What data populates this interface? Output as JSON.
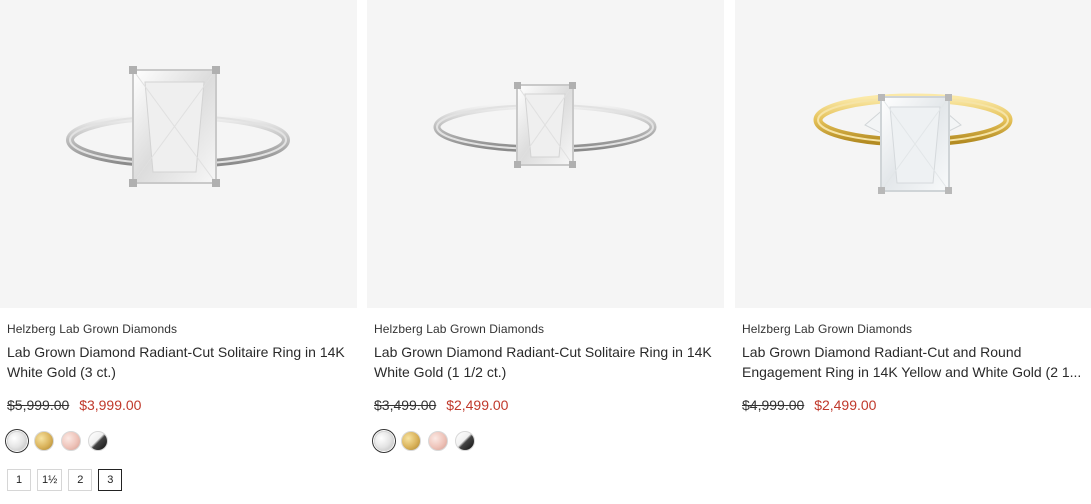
{
  "products": [
    {
      "brand": "Helzberg Lab Grown Diamonds",
      "title": "Lab Grown Diamond Radiant-Cut Solitaire Ring in 14K White Gold (3 ct.)",
      "original_price": "$5,999.00",
      "sale_price": "$3,999.00",
      "metal_swatches": [
        "white-gold",
        "yellow-gold",
        "rose-gold",
        "black-white"
      ],
      "selected_swatch": "white-gold",
      "carat_options": [
        "1",
        "1½",
        "2",
        "3"
      ],
      "selected_carat": "3"
    },
    {
      "brand": "Helzberg Lab Grown Diamonds",
      "title": "Lab Grown Diamond Radiant-Cut Solitaire Ring in 14K White Gold (1 1/2 ct.)",
      "original_price": "$3,499.00",
      "sale_price": "$2,499.00",
      "metal_swatches": [
        "white-gold",
        "yellow-gold",
        "rose-gold",
        "black-white"
      ],
      "selected_swatch": "white-gold"
    },
    {
      "brand": "Helzberg Lab Grown Diamonds",
      "title": "Lab Grown Diamond Radiant-Cut and Round Engagement Ring in 14K Yellow and White Gold (2 1...",
      "original_price": "$4,999.00",
      "sale_price": "$2,499.00"
    }
  ],
  "colors": {
    "sale_price": "#c0392b",
    "image_background": "#f5f5f5"
  }
}
